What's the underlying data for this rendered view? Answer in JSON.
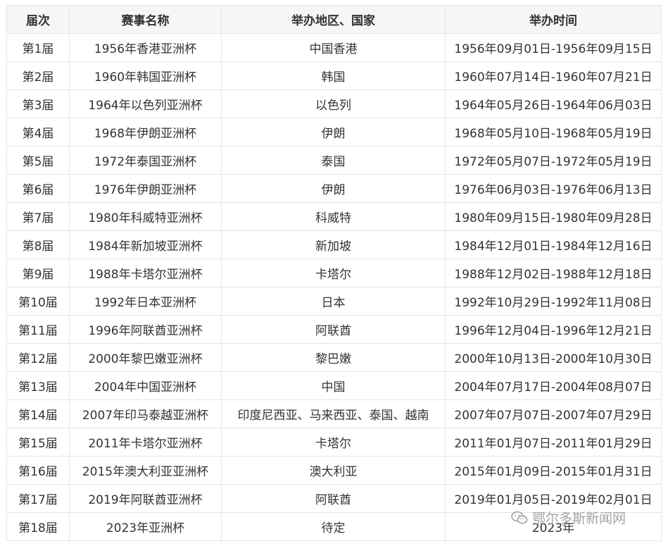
{
  "headers": {
    "edition": "届次",
    "name": "赛事名称",
    "host": "举办地区、国家",
    "dates": "举办时间"
  },
  "rows": [
    {
      "edition": "第1届",
      "name": "1956年香港亚洲杯",
      "host": "中国香港",
      "dates": "1956年09月01日-1956年09月15日"
    },
    {
      "edition": "第2届",
      "name": "1960年韩国亚洲杯",
      "host": "韩国",
      "dates": "1960年07月14日-1960年07月21日"
    },
    {
      "edition": "第3届",
      "name": "1964年以色列亚洲杯",
      "host": "以色列",
      "dates": "1964年05月26日-1964年06月03日"
    },
    {
      "edition": "第4届",
      "name": "1968年伊朗亚洲杯",
      "host": "伊朗",
      "dates": "1968年05月10日-1968年05月19日"
    },
    {
      "edition": "第5届",
      "name": "1972年泰国亚洲杯",
      "host": "泰国",
      "dates": "1972年05月07日-1972年05月19日"
    },
    {
      "edition": "第6届",
      "name": "1976年伊朗亚洲杯",
      "host": "伊朗",
      "dates": "1976年06月03日-1976年06月13日"
    },
    {
      "edition": "第7届",
      "name": "1980年科威特亚洲杯",
      "host": "科威特",
      "dates": "1980年09月15日-1980年09月28日"
    },
    {
      "edition": "第8届",
      "name": "1984年新加坡亚洲杯",
      "host": "新加坡",
      "dates": "1984年12月01日-1984年12月16日"
    },
    {
      "edition": "第9届",
      "name": "1988年卡塔尔亚洲杯",
      "host": "卡塔尔",
      "dates": "1988年12月02日-1988年12月18日"
    },
    {
      "edition": "第10届",
      "name": "1992年日本亚洲杯",
      "host": "日本",
      "dates": "1992年10月29日-1992年11月08日"
    },
    {
      "edition": "第11届",
      "name": "1996年阿联酋亚洲杯",
      "host": "阿联酋",
      "dates": "1996年12月04日-1996年12月21日"
    },
    {
      "edition": "第12届",
      "name": "2000年黎巴嫩亚洲杯",
      "host": "黎巴嫩",
      "dates": "2000年10月13日-2000年10月30日"
    },
    {
      "edition": "第13届",
      "name": "2004年中国亚洲杯",
      "host": "中国",
      "dates": "2004年07月17日-2004年08月07日"
    },
    {
      "edition": "第14届",
      "name": "2007年印马泰越亚洲杯",
      "host": "印度尼西亚、马来西亚、泰国、越南",
      "dates": "2007年07月07日-2007年07月29日"
    },
    {
      "edition": "第15届",
      "name": "2011年卡塔尔亚洲杯",
      "host": "卡塔尔",
      "dates": "2011年01月07日-2011年01月29日"
    },
    {
      "edition": "第16届",
      "name": "2015年澳大利亚亚洲杯",
      "host": "澳大利亚",
      "dates": "2015年01月09日-2015年01月31日"
    },
    {
      "edition": "第17届",
      "name": "2019年阿联酋亚洲杯",
      "host": "阿联酋",
      "dates": "2019年01月05日-2019年02月01日"
    },
    {
      "edition": "第18届",
      "name": "2023年亚洲杯",
      "host": "待定",
      "dates": "2023年"
    }
  ],
  "watermark": {
    "text": "鄂尔多斯新闻网",
    "icon": "wechat-icon"
  },
  "colors": {
    "link": "#136ec2",
    "text": "#333333",
    "border": "#e4e4e4",
    "header_bg": "#f6f6f6"
  }
}
